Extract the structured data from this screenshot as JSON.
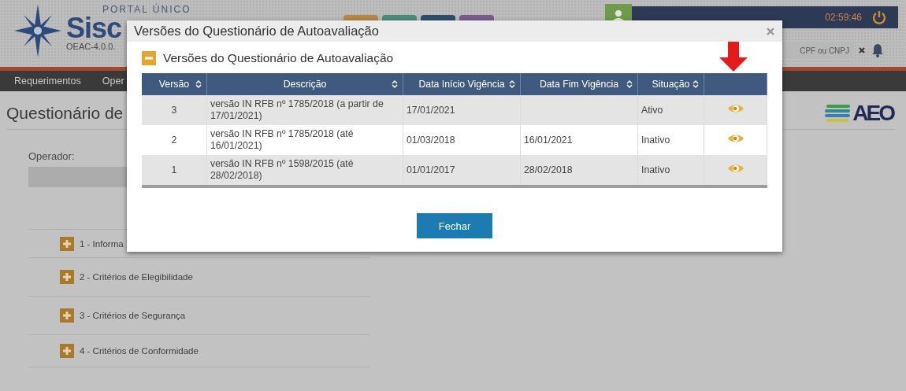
{
  "header": {
    "logo": {
      "tagline": "PORTAL ÚNICO",
      "name": "Sisc",
      "version": "OEAC-4.0.0."
    },
    "session_timer": "02:59:46",
    "search": {
      "placeholder": "CPF ou CNPJ"
    }
  },
  "nav": [
    "Requerimentos",
    "Oper"
  ],
  "page": {
    "title": "Questionário de",
    "brand": "AEO",
    "operator_label": "Operador:",
    "sections": [
      {
        "label": "1 - Informa",
        "expanded": false
      },
      {
        "label": "2 - Critérios de Elegibilidade",
        "expanded": false
      },
      {
        "label": "3 - Critérios de Segurança",
        "expanded": false
      },
      {
        "label": "4 - Critérios de Conformidade",
        "expanded": false
      }
    ]
  },
  "dialog": {
    "title": "Versões do Questionário de Autoavaliação",
    "panel": {
      "title": "Versões do Questionário de Autoavaliação",
      "expanded": true
    },
    "columns": [
      "Versão",
      "Descrição",
      "Data Início Vigência",
      "Data Fim Vigência",
      "Situação"
    ],
    "rows": [
      {
        "version": "3",
        "description": "versão IN RFB nº 1785/2018 (a partir de 17/01/2021)",
        "start": "17/01/2021",
        "status": "Ativo"
      },
      {
        "version": "2",
        "description": "versão IN RFB nº 1785/2018 (até 16/01/2021)",
        "start": "01/03/2018",
        "end": "16/01/2021",
        "status": "Inativo"
      },
      {
        "version": "1",
        "description": "versão IN RFB nº 1598/2015 (até 28/02/2018)",
        "start": "01/01/2017",
        "end": "28/02/2018",
        "status": "Inativo"
      }
    ],
    "close_button": "Fechar"
  }
}
